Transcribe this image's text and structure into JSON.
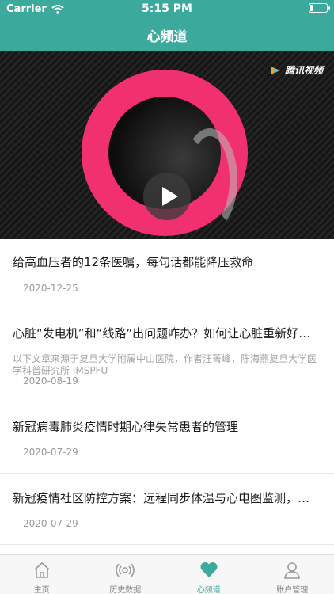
{
  "status_bar": {
    "carrier": "Carrier",
    "time": "5:15 PM",
    "battery_level": 0.15
  },
  "nav": {
    "title": "心频道"
  },
  "video": {
    "brand": "腾讯视频",
    "play_icon": "play-icon"
  },
  "articles": [
    {
      "title": "给高血压者的12条医嘱，每句话都能降压救命",
      "date": "2020-12-25"
    },
    {
      "title": "心脏“发电机”和“线路”出问题咋办？如何让心脏重新好起来",
      "description": "以下文章来源于复旦大学附属中山医院，作者汪菁峰，陈海燕复旦大学医学科普研究所 IMSPFU",
      "date": "2020-08-19"
    },
    {
      "title": "新冠病毒肺炎疫情时期心律失常患者的管理",
      "date": "2020-07-29"
    },
    {
      "title": "新冠疫情社区防控方案：远程同步体温与心电图监测，及时发现",
      "date": "2020-07-29"
    }
  ],
  "tabbar": {
    "accent": "#3ba99b",
    "tabs": [
      {
        "label": "主页",
        "icon": "home-icon"
      },
      {
        "label": "历史数据",
        "icon": "signal-icon"
      },
      {
        "label": "心频道",
        "icon": "heart-icon"
      },
      {
        "label": "账户管理",
        "icon": "user-icon"
      }
    ],
    "active_index": 2
  }
}
